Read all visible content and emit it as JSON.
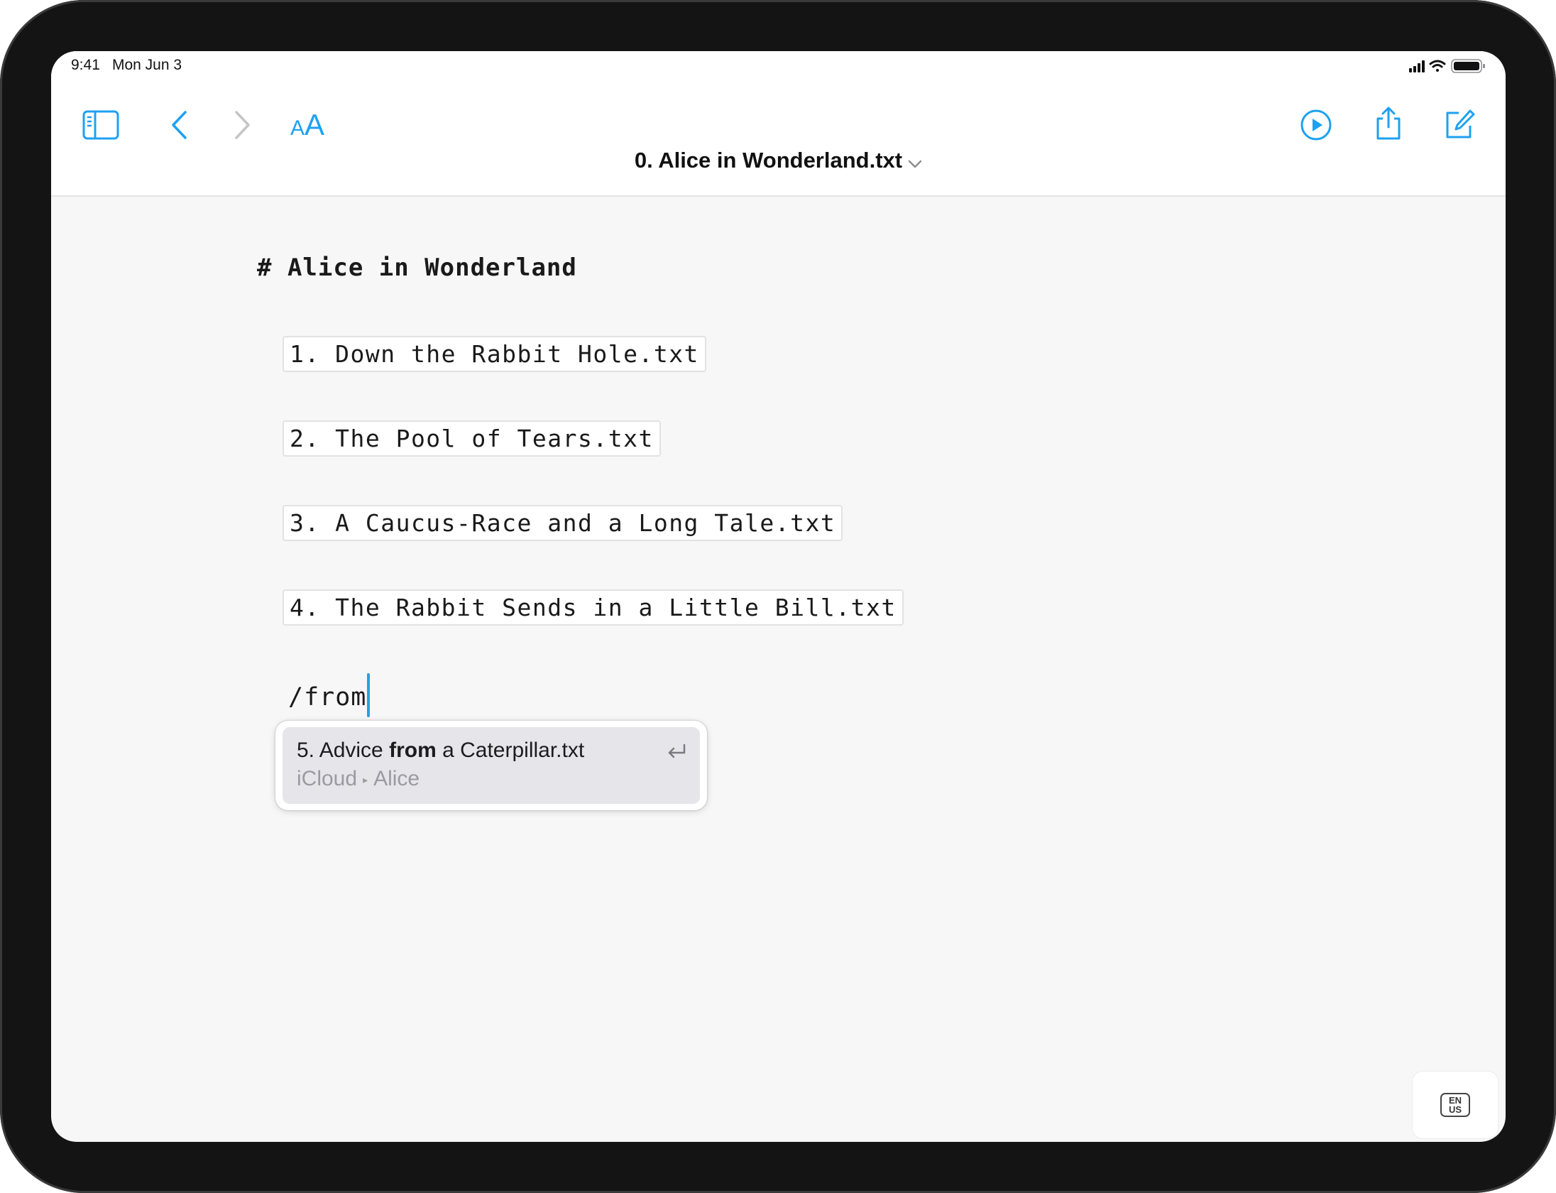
{
  "status_bar": {
    "time": "9:41",
    "date": "Mon Jun 3",
    "icons": [
      "cellular-signal-icon",
      "wifi-icon",
      "battery-icon"
    ]
  },
  "toolbar": {
    "document_title": "0. Alice in Wonderland.txt",
    "left_icons": [
      "sidebar-icon",
      "back-icon",
      "forward-icon",
      "text-size-icon"
    ],
    "right_icons": [
      "play-icon",
      "share-icon",
      "compose-icon"
    ],
    "text_size_label": "AA",
    "accent_color": "#1ea1f1"
  },
  "editor": {
    "heading": "# Alice in Wonderland",
    "links": [
      "1. Down the Rabbit Hole.txt",
      "2. The Pool of Tears.txt",
      "3. A Caucus-Race and a Long Tale.txt",
      "4. The Rabbit Sends in a Little Bill.txt"
    ],
    "typed_text": "/from"
  },
  "autocomplete": {
    "title_prefix": "5. Advice ",
    "title_match": "from",
    "title_suffix": " a Caterpillar.txt",
    "path_root": "iCloud",
    "path_folder": "Alice",
    "icon": "return-icon"
  },
  "keyboard_button": {
    "line1": "EN",
    "line2": "US"
  }
}
